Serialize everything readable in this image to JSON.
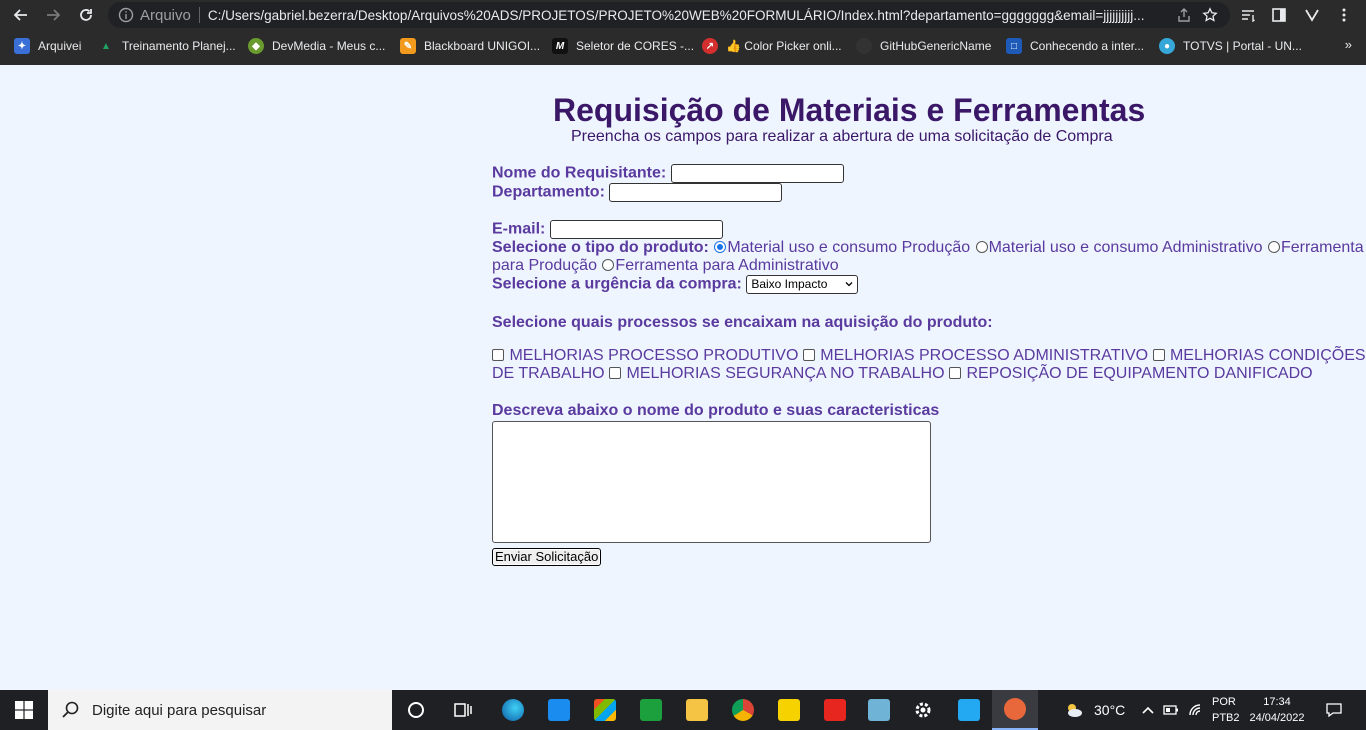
{
  "browser": {
    "scheme_label": "Arquivo",
    "url": "C:/Users/gabriel.bezerra/Desktop/Arquivos%20ADS/PROJETOS/PROJETO%20WEB%20FORMULÁRIO/Index.html?departamento=ggggggg&email=jjjjjjjjjj...",
    "bookmarks": [
      {
        "label": "Arquivei",
        "color": "#3b6fd8"
      },
      {
        "label": "Treinamento Planej...",
        "color": "#1fa463"
      },
      {
        "label": "DevMedia - Meus c...",
        "color": "#6a9b2f"
      },
      {
        "label": "Blackboard UNIGOI...",
        "color": "#f29a1e"
      },
      {
        "label": "Seletor de CORES -...",
        "color": "#222222"
      },
      {
        "label": "👍 Color Picker onli...",
        "color": "#d32f2f"
      },
      {
        "label": "GitHubGenericName",
        "color": "#333333"
      },
      {
        "label": "Conhecendo a inter...",
        "color": "#1e5bb8"
      },
      {
        "label": "TOTVS | Portal - UN...",
        "color": "#35a7d8"
      }
    ],
    "more": "»"
  },
  "form": {
    "title": "Requisição de Materiais e Ferramentas",
    "subtitle": "Preencha os campos para realizar a abertura de uma solicitação de Compra",
    "name_label": "Nome do Requisitante:",
    "name_value": "",
    "dept_label": "Departamento:",
    "dept_value": "",
    "email_label": "E-mail:",
    "email_value": "",
    "product_type_label": "Selecione o tipo do produto:",
    "product_types": [
      {
        "label": "Material uso e consumo Produção",
        "checked": true
      },
      {
        "label": "Material uso e consumo Administrativo",
        "checked": false
      },
      {
        "label": "Ferramenta para Produção",
        "checked": false
      },
      {
        "label": "Ferramenta para Administrativo",
        "checked": false
      }
    ],
    "urgency_label": "Selecione a urgência da compra:",
    "urgency_selected": "Baixo Impacto",
    "process_label": "Selecione quais processos se encaixam na aquisição do produto:",
    "processes": [
      "MELHORIAS PROCESSO PRODUTIVO",
      "MELHORIAS PROCESSO ADMINISTRATIVO",
      "MELHORIAS CONDIÇÕES DE TRABALHO",
      "MELHORIAS SEGURANÇA NO TRABALHO",
      "REPOSIÇÃO DE EQUIPAMENTO DANIFICADO"
    ],
    "description_label": "Descreva abaixo o nome do produto e suas caracteristicas",
    "description_value": "",
    "submit_label": "Enviar Solicitação",
    "colors": {
      "title": "#3b1768",
      "label": "#5a3a9e",
      "background": "#eef5ff"
    }
  },
  "taskbar": {
    "search_placeholder": "Digite aqui para pesquisar",
    "temperature": "30°C",
    "lang_1": "POR",
    "lang_2": "PTB2",
    "time": "17:34",
    "date": "24/04/2022"
  }
}
